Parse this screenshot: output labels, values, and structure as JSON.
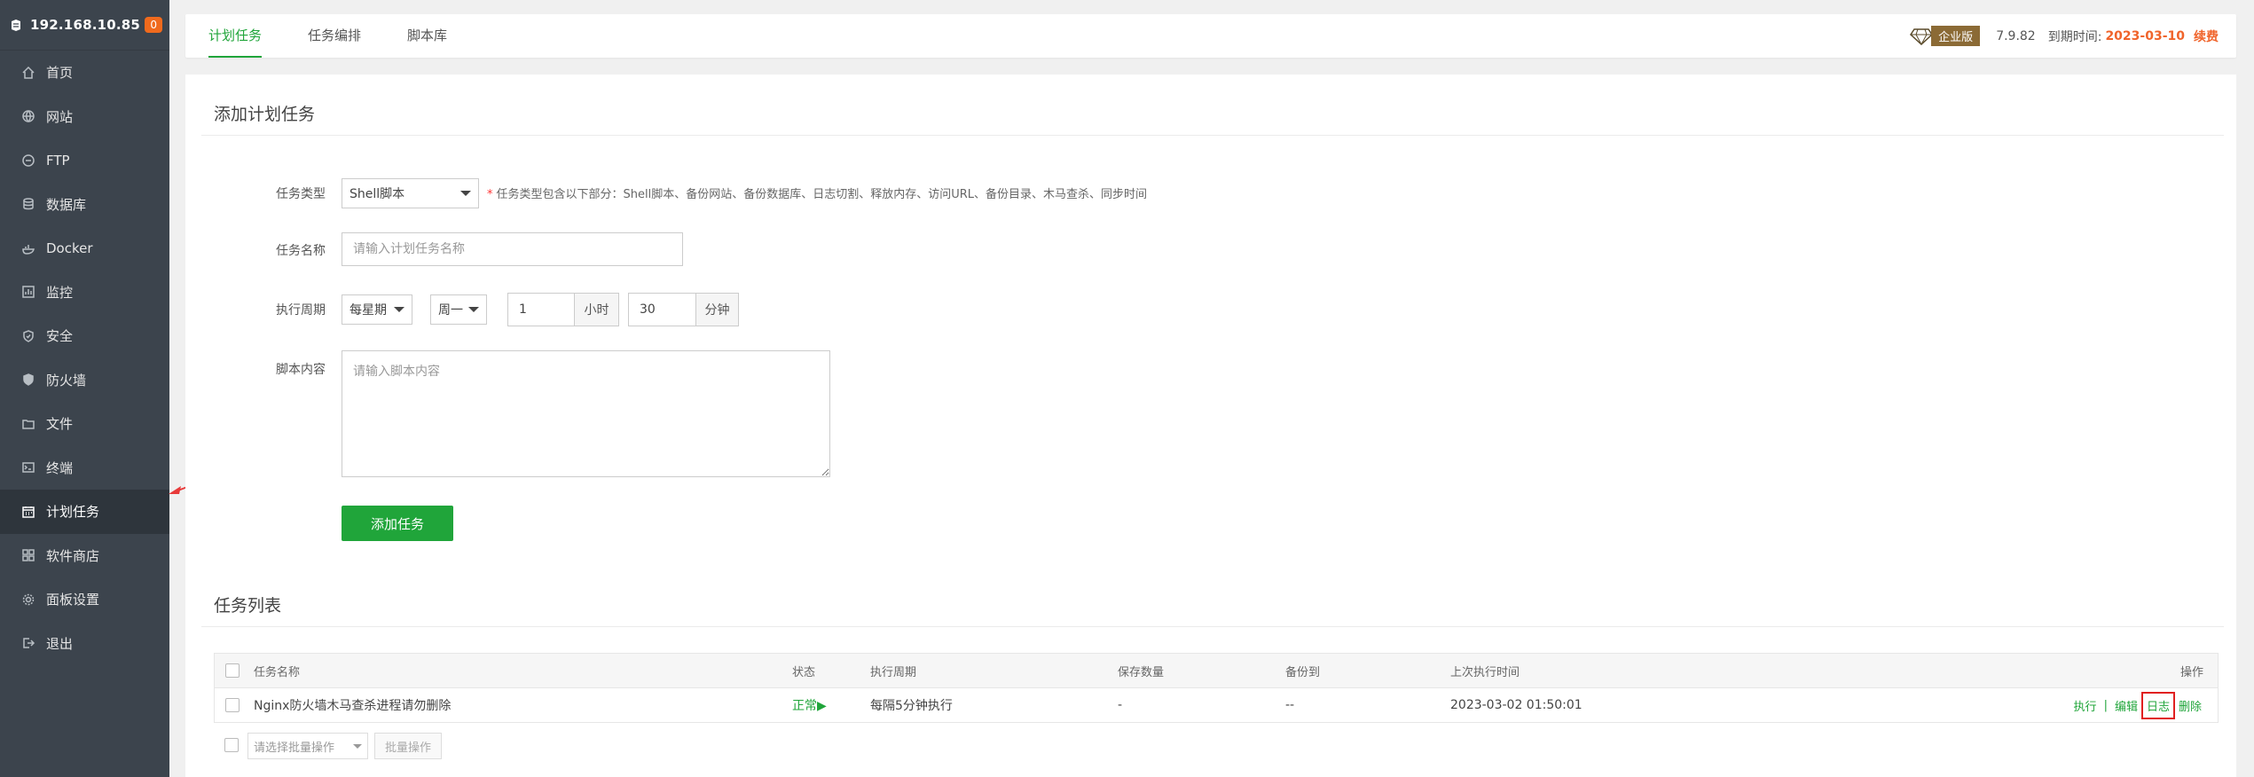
{
  "sidebar": {
    "server_ip": "192.168.10.85",
    "badge_count": "0",
    "items": [
      {
        "label": "首页",
        "icon": "home-icon"
      },
      {
        "label": "网站",
        "icon": "globe-icon"
      },
      {
        "label": "FTP",
        "icon": "ftp-icon"
      },
      {
        "label": "数据库",
        "icon": "database-icon"
      },
      {
        "label": "Docker",
        "icon": "docker-icon"
      },
      {
        "label": "监控",
        "icon": "monitor-icon"
      },
      {
        "label": "安全",
        "icon": "shield-icon"
      },
      {
        "label": "防火墙",
        "icon": "firewall-icon"
      },
      {
        "label": "文件",
        "icon": "folder-icon"
      },
      {
        "label": "终端",
        "icon": "terminal-icon"
      },
      {
        "label": "计划任务",
        "icon": "calendar-icon",
        "active": true
      },
      {
        "label": "软件商店",
        "icon": "store-icon"
      },
      {
        "label": "面板设置",
        "icon": "gear-icon"
      },
      {
        "label": "退出",
        "icon": "logout-icon"
      }
    ]
  },
  "header": {
    "tabs": [
      {
        "label": "计划任务",
        "active": true
      },
      {
        "label": "任务编排"
      },
      {
        "label": "脚本库"
      }
    ],
    "edition": "企业版",
    "version": "7.9.82",
    "expire_label": "到期时间:",
    "expire_date": "2023-03-10",
    "renew_label": "续费"
  },
  "form": {
    "title": "添加计划任务",
    "type_label": "任务类型",
    "type_value": "Shell脚本",
    "type_hint": "任务类型包含以下部分：Shell脚本、备份网站、备份数据库、日志切割、释放内存、访问URL、备份目录、木马查杀、同步时间",
    "name_label": "任务名称",
    "name_placeholder": "请输入计划任务名称",
    "period_label": "执行周期",
    "period_type": "每星期",
    "weekday": "周一",
    "hour_value": "1",
    "hour_unit": "小时",
    "minute_value": "30",
    "minute_unit": "分钟",
    "script_label": "脚本内容",
    "script_placeholder": "请输入脚本内容",
    "submit_label": "添加任务"
  },
  "task_list": {
    "title": "任务列表",
    "columns": [
      "任务名称",
      "状态",
      "执行周期",
      "保存数量",
      "备份到",
      "上次执行时间",
      "操作"
    ],
    "rows": [
      {
        "name": "Nginx防火墙木马查杀进程请勿删除",
        "status": "正常▶",
        "period": "每隔5分钟执行",
        "keep": "-",
        "backup_to": "--",
        "last_run": "2023-03-02 01:50:01",
        "ops": {
          "run": "执行",
          "edit": "编辑",
          "log": "日志",
          "delete": "删除",
          "sep": "|"
        }
      }
    ],
    "batch_placeholder": "请选择批量操作",
    "batch_button": "批量操作"
  },
  "colors": {
    "accent": "#20a53a",
    "sidebar_bg": "#3c444d",
    "warning": "#f0642b",
    "highlight_box": "#e02020"
  }
}
